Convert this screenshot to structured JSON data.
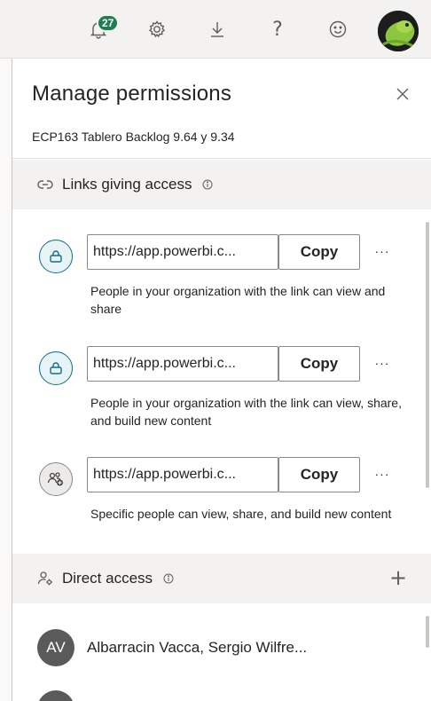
{
  "topbar": {
    "notification_count": "27",
    "help_glyph": "?",
    "icons": [
      "bell-icon",
      "gear-icon",
      "download-icon",
      "help-icon",
      "smiley-icon"
    ]
  },
  "panel": {
    "title": "Manage permissions",
    "subtitle": "ECP163 Tablero Backlog 9.64 y 9.34",
    "links_section": {
      "label": "Links giving access"
    },
    "links": [
      {
        "icon": "org-link-icon",
        "url": "https://app.powerbi.c...",
        "copy_label": "Copy",
        "more_label": "···",
        "description": "People in your organization with the link can view and share"
      },
      {
        "icon": "org-link-icon",
        "url": "https://app.powerbi.c...",
        "copy_label": "Copy",
        "more_label": "···",
        "description": "People in your organization with the link can view, share, and build new content"
      },
      {
        "icon": "specific-people-icon",
        "url": "https://app.powerbi.c...",
        "copy_label": "Copy",
        "more_label": "···",
        "description": "Specific people can view, share, and build new content"
      }
    ],
    "direct_section": {
      "label": "Direct access",
      "add_label": "+"
    },
    "people": [
      {
        "initials": "AV",
        "name": "Albarracin Vacca, Sergio Wilfre..."
      }
    ]
  },
  "colors": {
    "badge": "#1b7f4f",
    "org_icon_accent": "#0f6f8a",
    "section_bg": "#f3f2f1",
    "avatar_bg": "#5a5a5a"
  }
}
